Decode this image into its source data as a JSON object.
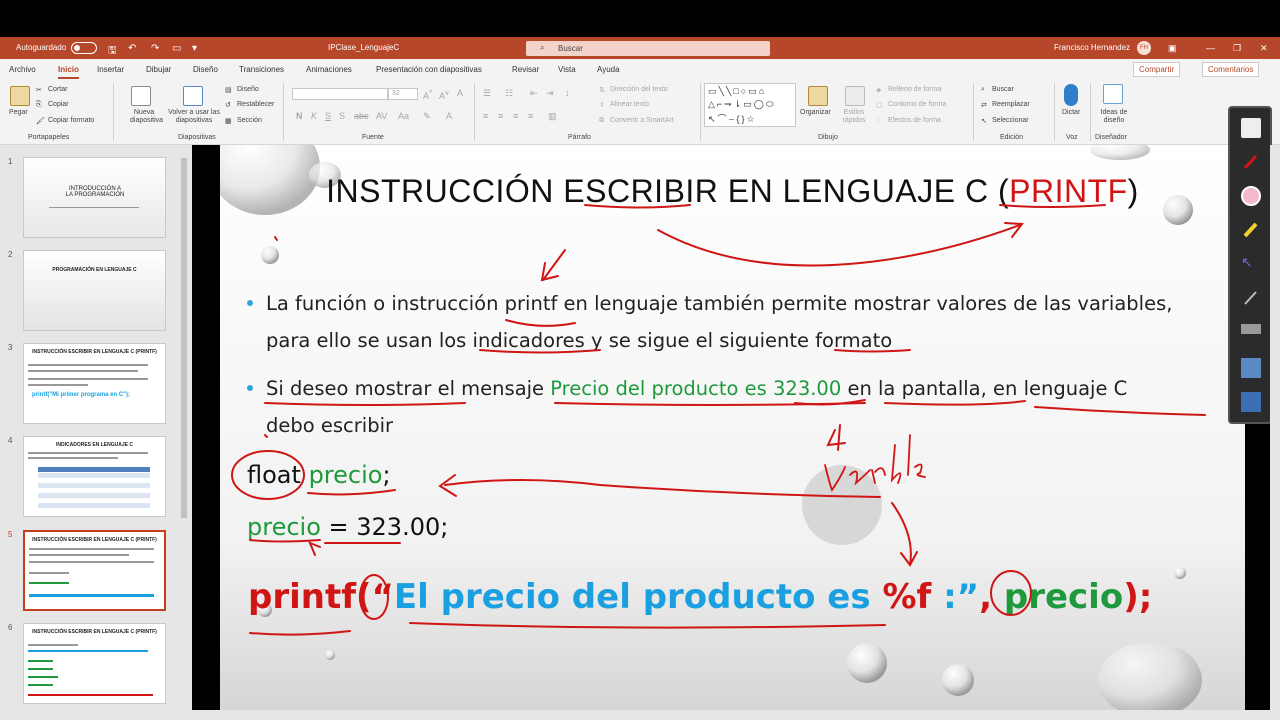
{
  "titlebar": {
    "autosave": "Autoguardado",
    "filename": "IPClase_LenguajeC",
    "search_placeholder": "Buscar",
    "user": "Francisco Hernandez",
    "user_initials": "FH"
  },
  "tabs": [
    "Archivo",
    "Inicio",
    "Insertar",
    "Dibujar",
    "Diseño",
    "Transiciones",
    "Animaciones",
    "Presentación con diapositivas",
    "Revisar",
    "Vista",
    "Ayuda"
  ],
  "active_tab": "Inicio",
  "share": {
    "compartir": "Compartir",
    "comentarios": "Comentarios"
  },
  "ribbon": {
    "portapapeles": {
      "pegar": "Pegar",
      "cortar": "Cortar",
      "copiar": "Copiar",
      "copiar_formato": "Copiar formato",
      "label": "Portapapeles"
    },
    "diapositivas": {
      "nueva": "Nueva diapositiva",
      "volver": "Volver a usar las diapositivas",
      "diseno": "Diseño",
      "restablecer": "Restablecer",
      "seccion": "Sección",
      "label": "Diapositivas"
    },
    "fuente": {
      "size": "32",
      "label": "Fuente"
    },
    "parrafo": {
      "direccion": "Dirección del texto",
      "alinear": "Alinear texto",
      "convertir": "Convertir a SmartArt",
      "label": "Párrafo"
    },
    "dibujo": {
      "organizar": "Organizar",
      "estilos": "Estilos rápidos",
      "relleno": "Relleno de forma",
      "contorno": "Contorno de forma",
      "efectos": "Efectos de forma",
      "label": "Dibujo"
    },
    "edicion": {
      "buscar": "Buscar",
      "reemplazar": "Reemplazar",
      "seleccionar": "Seleccionar",
      "label": "Edición"
    },
    "voz": {
      "dictar": "Dictar",
      "label": "Voz"
    },
    "disenador": {
      "ideas": "Ideas de diseño",
      "label": "Diseñador"
    }
  },
  "thumbnails": [
    {
      "num": "1",
      "title": "INTRODUCCIÓN A LA PROGRAMACIÓN"
    },
    {
      "num": "2",
      "title": "PROGRAMACIÓN EN LENGUAJE C"
    },
    {
      "num": "3",
      "title": "INSTRUCCIÓN ESCRIBIR EN LENGUAJE C (PRINTF)",
      "code": "printf(\"Mi primer programa en C\");"
    },
    {
      "num": "4",
      "title": "INDICADORES EN LENGUAJE C"
    },
    {
      "num": "5",
      "title": "INSTRUCCIÓN ESCRIBIR EN LENGUAJE C (PRINTF)"
    },
    {
      "num": "6",
      "title": "INSTRUCCIÓN ESCRIBIR EN LENGUAJE C (PRINTF)"
    }
  ],
  "selected_slide": "5",
  "slide": {
    "title_main": "INSTRUCCIÓN ESCRIBIR EN LENGUAJE C (",
    "title_printf": "PRINTF",
    "title_close": ")",
    "b1_a": "La función o instrucción ",
    "b1_printf": "printf",
    "b1_b": " en lenguaje también permite mostrar valores de las variables,",
    "b1_c": "para ello se usan los indicadores y se sigue el siguiente formato",
    "b2_a": "Si deseo mostrar el mensaje ",
    "b2_green": "Precio del producto es 323.00",
    "b2_b": " en la pantalla, en lenguaje C",
    "b2_c": "debo escribir",
    "code1_type": "float",
    "code1_var": "precio",
    "code1_end": ";",
    "code2_var": "precio",
    "code2_rest": " = 323.00;",
    "printf_fn": "printf(",
    "printf_q1": "“",
    "printf_text": "El precio del producto es ",
    "printf_fmt": "%f",
    "printf_q2": " :”",
    "printf_comma": ", ",
    "printf_var": "precio",
    "printf_end": ");",
    "ink_word": "variable"
  },
  "colors": {
    "accent": "#b7472a",
    "code_red": "#d01515",
    "code_blue": "#1aa0e0",
    "code_green": "#1e9a3c",
    "bullet": "#2ea3dc"
  }
}
